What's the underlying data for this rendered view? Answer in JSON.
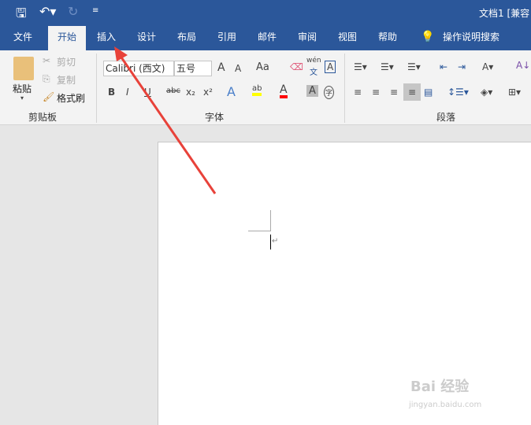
{
  "title": "文档1 [兼容",
  "quick_access": {
    "save": "save-icon",
    "undo": "undo-icon",
    "redo": "redo-icon",
    "customize": "customize-icon"
  },
  "tabs": [
    "文件",
    "开始",
    "插入",
    "设计",
    "布局",
    "引用",
    "邮件",
    "审阅",
    "视图",
    "帮助"
  ],
  "tell_me": "操作说明搜索",
  "clipboard": {
    "paste": "粘贴",
    "cut": "剪切",
    "copy": "复制",
    "format_painter": "格式刷",
    "group": "剪贴板"
  },
  "font": {
    "name": "Calibri (西文)",
    "size": "五号",
    "grow": "A",
    "shrink": "A",
    "case": "Aa",
    "phonetic": "wén",
    "phonetic_char": "文",
    "border_char": "A",
    "bold": "B",
    "italic": "I",
    "underline": "U",
    "strike": "abc",
    "sub": "x₂",
    "sup": "x²",
    "effects": "A",
    "highlight": "ab",
    "color": "A",
    "shade": "A",
    "enclose": "字",
    "group": "字体"
  },
  "paragraph": {
    "group": "段落"
  },
  "colors": {
    "accent": "#2b579a",
    "highlight": "#ffff00",
    "font_color": "#ff0000",
    "arrow": "#e8423a"
  },
  "watermark": {
    "brand": "Bai 经验",
    "url": "jingyan.baidu.com"
  }
}
